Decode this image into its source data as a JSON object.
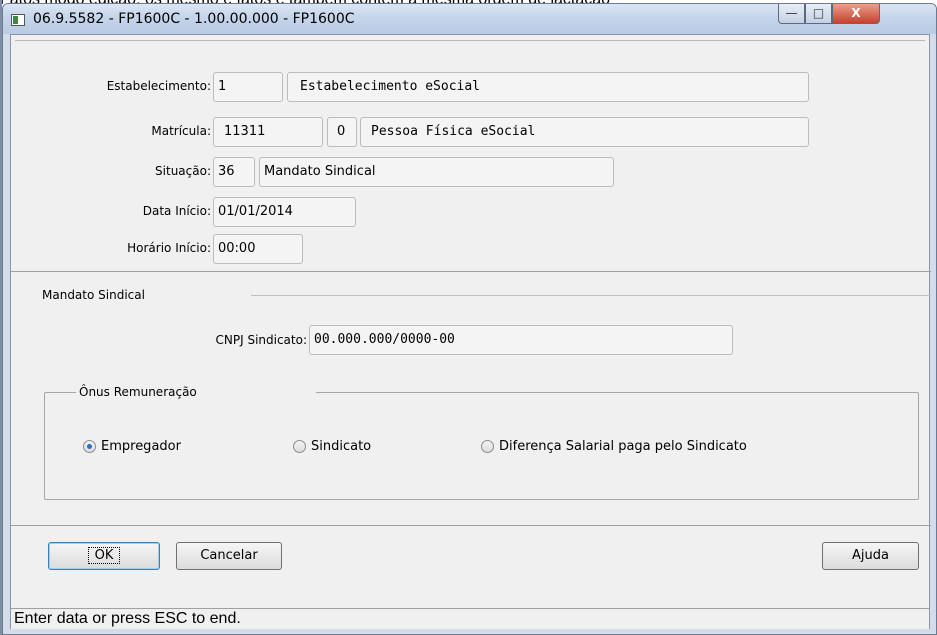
{
  "background": {
    "cut_text": "Fatos modo edição, os mesmo é fatos e também contém a mesma ordem de lactação"
  },
  "window": {
    "title": "06.9.5582 - FP1600C - 1.00.00.000 - FP1600C",
    "min_glyph": "—",
    "max_glyph": "□",
    "close_glyph": "X"
  },
  "form": {
    "estabelecimento": {
      "label": "Estabelecimento:",
      "code": "1",
      "name": "Estabelecimento eSocial"
    },
    "matricula": {
      "label": "Matrícula:",
      "number": "11311",
      "digit": "0",
      "name": "Pessoa Física eSocial"
    },
    "situacao": {
      "label": "Situação:",
      "code": "36",
      "name": "Mandato Sindical"
    },
    "data_inicio": {
      "label": "Data Início:",
      "value": "01/01/2014"
    },
    "horario_inicio": {
      "label": "Horário Início:",
      "value": "00:00"
    }
  },
  "mandato": {
    "section_title": "Mandato Sindical",
    "cnpj_label": "CNPJ Sindicato:",
    "cnpj_value": "00.000.000/0000-00",
    "onus": {
      "title": "Ônus Remuneração",
      "options": [
        {
          "label": "Empregador",
          "selected": true
        },
        {
          "label": "Sindicato",
          "selected": false
        },
        {
          "label": "Diferença Salarial paga pelo Sindicato",
          "selected": false
        }
      ]
    }
  },
  "buttons": {
    "ok": "OK",
    "cancel": "Cancelar",
    "help": "Ajuda"
  },
  "status_bar": "Enter data or press ESC to end.",
  "colors": {
    "title_bar": "#c5d5ea",
    "dialog_bg": "#f0f0f0",
    "close_button": "#c8412c",
    "radio_selected": "#2c6fc7"
  }
}
